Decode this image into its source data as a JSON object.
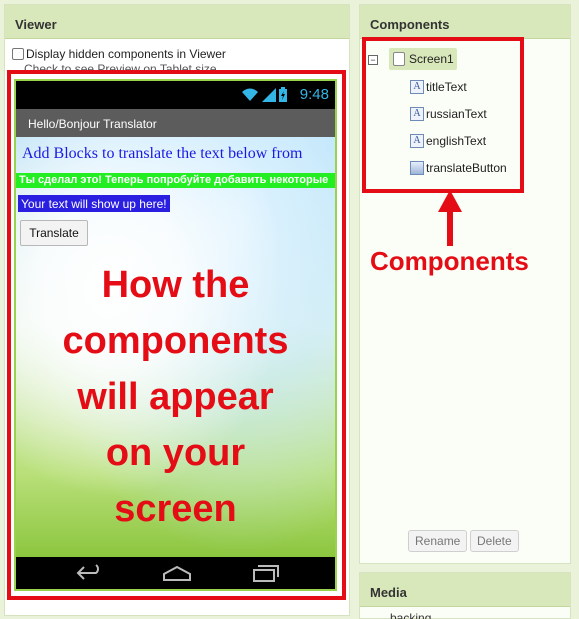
{
  "viewer": {
    "header": "Viewer",
    "hidden_components_label": "Display hidden components in Viewer",
    "tablet_preview_label": "Check to see Preview on Tablet size."
  },
  "phone": {
    "status_time": "9:48",
    "app_title": "Hello/Bonjour Translator",
    "title_text": "Add Blocks to translate the text below from",
    "russian_text": "Ты сделал это! Теперь попробуйте добавить некоторые",
    "english_text": "Your text will show up here!",
    "translate_button": "Translate",
    "caption_lines": [
      "How the",
      "components",
      "will appear",
      "on your",
      "screen"
    ]
  },
  "components": {
    "header": "Components",
    "root": "Screen1",
    "children": [
      "titleText",
      "russianText",
      "englishText",
      "translateButton"
    ],
    "caption": "Components",
    "rename_label": "Rename",
    "delete_label": "Delete"
  },
  "media": {
    "header": "Media",
    "first_item": "backing"
  },
  "colors": {
    "annotation_red": "#e50d15",
    "panel_header_green": "#d9e8bb",
    "title_text_blue": "#1a1ae6",
    "russian_bg_green": "#22ee22",
    "english_bg_blue": "#2a1ee0"
  }
}
